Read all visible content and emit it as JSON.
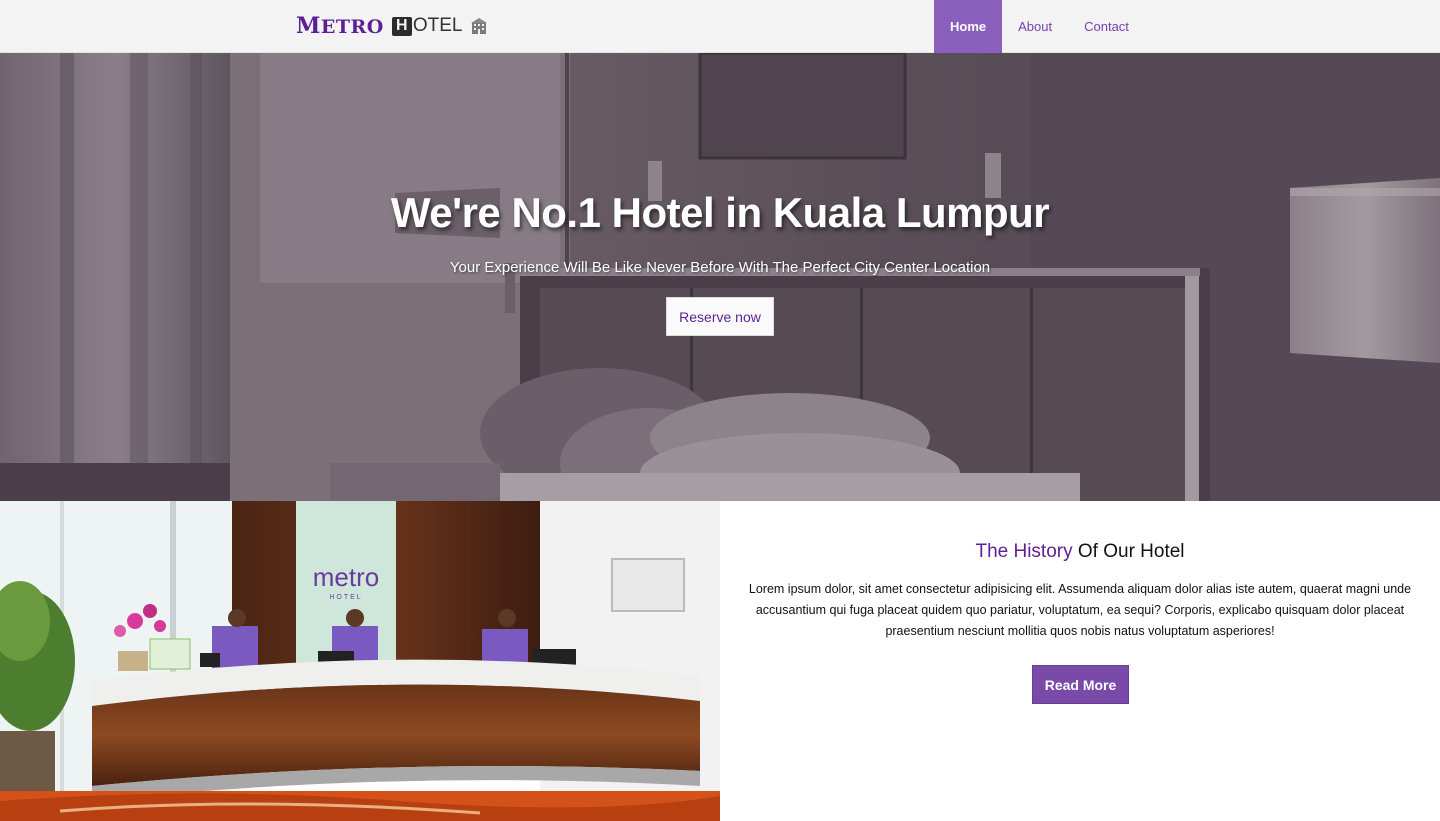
{
  "navbar": {
    "brand_metro_first": "M",
    "brand_metro_rest": "ETRO",
    "brand_hotel_first": "H",
    "brand_hotel_rest": "OTEL",
    "links": [
      {
        "label": "Home",
        "active": true
      },
      {
        "label": "About",
        "active": false
      },
      {
        "label": "Contact",
        "active": false
      }
    ]
  },
  "hero": {
    "title": "We're No.1 Hotel in Kuala Lumpur",
    "subtitle": "Your Experience Will Be Like Never Before With The Perfect City Center Location",
    "cta_label": "Reserve now"
  },
  "history": {
    "title_accent": "The History",
    "title_rest": " Of Our Hotel",
    "body": "Lorem ipsum dolor, sit amet consectetur adipisicing elit. Assumenda aliquam dolor alias iste autem, quaerat magni unde accusantium qui fuga placeat quidem quo pariatur, voluptatum, ea sequi? Corporis, explicabo quisquam dolor placeat praesentium nesciunt mollitia quos nobis natus voluptatum asperiores!",
    "button_label": "Read More"
  },
  "lobby_sign": {
    "brand": "metro",
    "sub": "HOTEL"
  },
  "colors": {
    "brand_purple": "#5e1f96",
    "nav_active_bg": "#8b5fbd",
    "button_purple": "#7a4aa8",
    "hero_overlay": "#4a3d4a"
  },
  "icons": {
    "brand_icon": "building-icon"
  }
}
